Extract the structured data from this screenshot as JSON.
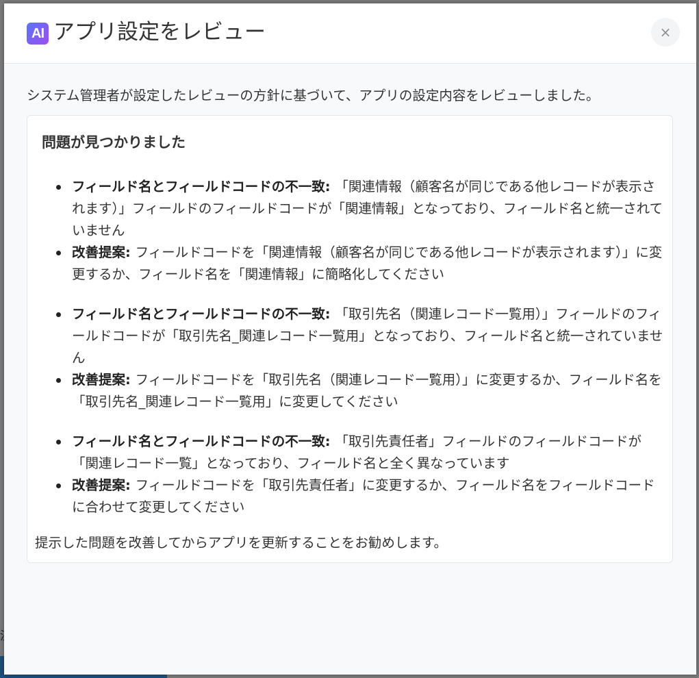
{
  "backdrop": {
    "fragment_text": "決"
  },
  "dialog": {
    "badge_text": "AI",
    "title": "アプリ設定をレビュー",
    "close_label": "×",
    "intro": "システム管理者が設定したレビューの方針に基づいて、アプリの設定内容をレビューしました。"
  },
  "card": {
    "heading": "問題が見つかりました",
    "groups": [
      {
        "problem_label": "フィールド名とフィールドコードの不一致",
        "problem_text": "「関連情報（顧客名が同じである他レコードが表示されます）」フィールドのフィールドコードが「関連情報」となっており、フィールド名と統一されていません",
        "suggestion_label": "改善提案",
        "suggestion_text": "フィールドコードを「関連情報（顧客名が同じである他レコードが表示されます）」に変更するか、フィールド名を「関連情報」に簡略化してください"
      },
      {
        "problem_label": "フィールド名とフィールドコードの不一致",
        "problem_text": "「取引先名（関連レコード一覧用）」フィールドのフィールドコードが「取引先名_関連レコード一覧用」となっており、フィールド名と統一されていません",
        "suggestion_label": "改善提案",
        "suggestion_text": "フィールドコードを「取引先名（関連レコード一覧用）」に変更するか、フィールド名を「取引先名_関連レコード一覧用」に変更してください"
      },
      {
        "problem_label": "フィールド名とフィールドコードの不一致",
        "problem_text": "「取引先責任者」フィールドのフィールドコードが「関連レコード一覧」となっており、フィールド名と全く異なっています",
        "suggestion_label": "改善提案",
        "suggestion_text": "フィールドコードを「取引先責任者」に変更するか、フィールド名をフィールドコードに合わせて変更してください"
      }
    ],
    "footer": "提示した問題を改善してからアプリを更新することをお勧めします。"
  },
  "colors": {
    "badge_gradient_start": "#5a74f5",
    "badge_gradient_end": "#9d4ef0",
    "modal_background": "#f7f9fa",
    "card_background": "#ffffff"
  },
  "icons": {
    "close": "close-icon",
    "ai": "ai-badge-icon"
  }
}
